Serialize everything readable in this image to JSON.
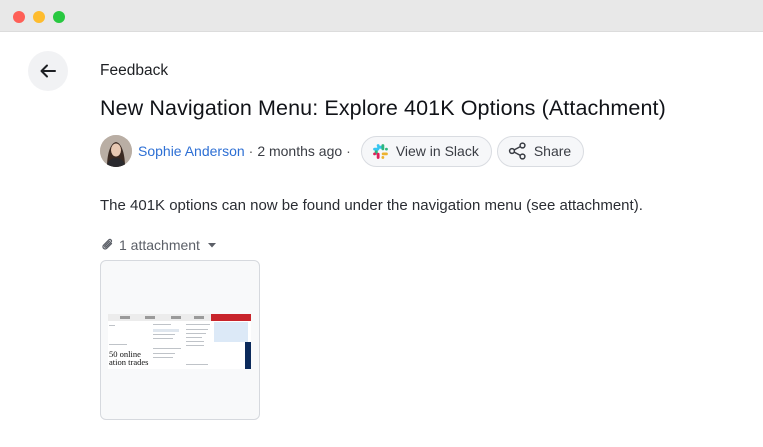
{
  "window": {
    "controls": [
      "close",
      "minimize",
      "zoom"
    ]
  },
  "navigation": {
    "back_icon": "arrow-left-icon"
  },
  "post": {
    "breadcrumb": "Feedback",
    "title": "New Navigation Menu: Explore 401K Options (Attachment)",
    "author": "Sophie Anderson",
    "time_sep": "·",
    "timestamp": "2 months ago",
    "trail_sep": "·",
    "body": "The 401K options can now be found under the navigation menu (see attachment)."
  },
  "actions": {
    "view_in_slack": "View in Slack",
    "share": "Share"
  },
  "attachments": {
    "summary": "1 attachment",
    "items": [
      {
        "preview_text": "50 online\nation trades"
      }
    ]
  },
  "colors": {
    "link": "#2d6fd4",
    "pill_border": "#d9dce1",
    "titlebar": "#e8e8e8"
  }
}
